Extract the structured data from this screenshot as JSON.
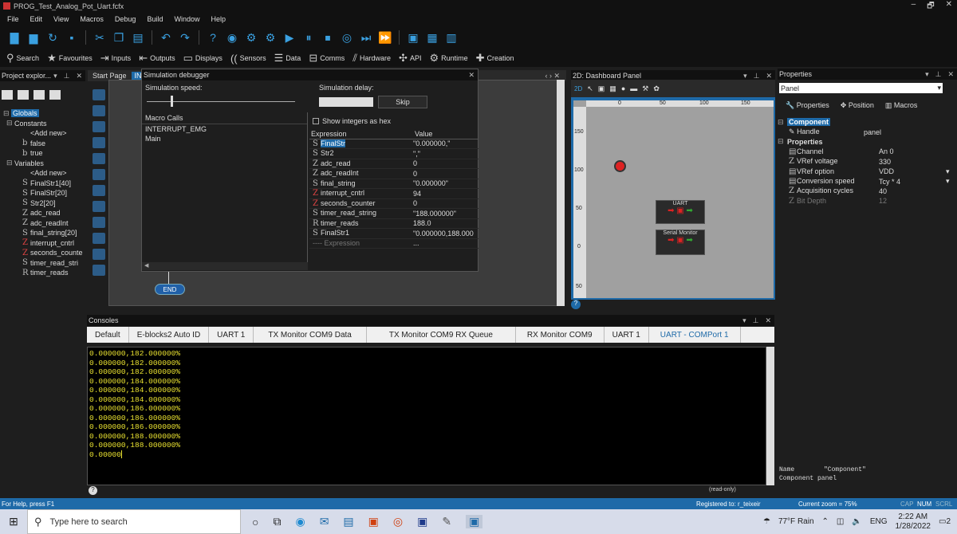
{
  "window": {
    "title": "PROG_Test_Analog_Pot_Uart.fcfx",
    "controls": [
      "–",
      "🗗",
      "✕"
    ]
  },
  "menu": [
    "File",
    "Edit",
    "View",
    "Macros",
    "Debug",
    "Build",
    "Window",
    "Help"
  ],
  "commands": [
    {
      "icon": "search-icon",
      "label": "Search"
    },
    {
      "icon": "star-icon",
      "label": "Favourites"
    },
    {
      "icon": "inputs-icon",
      "label": "Inputs"
    },
    {
      "icon": "outputs-icon",
      "label": "Outputs"
    },
    {
      "icon": "displays-icon",
      "label": "Displays"
    },
    {
      "icon": "sensors-icon",
      "label": "Sensors"
    },
    {
      "icon": "data-icon",
      "label": "Data"
    },
    {
      "icon": "comms-icon",
      "label": "Comms"
    },
    {
      "icon": "hardware-icon",
      "label": "Hardware"
    },
    {
      "icon": "api-icon",
      "label": "API"
    },
    {
      "icon": "runtime-icon",
      "label": "Runtime"
    },
    {
      "icon": "creation-icon",
      "label": "Creation"
    }
  ],
  "project": {
    "title": "Project explor...",
    "items": [
      "Globals",
      "Constants",
      "<Add new>",
      "false",
      "true",
      "Variables",
      "<Add new>",
      "FinalStr1[40]",
      "FinalStr[20]",
      "Str2[20]",
      "adc_read",
      "adc_readInt",
      "final_string[20]",
      "interrupt_cntrl",
      "seconds_counte",
      "timer_read_stri",
      "timer_reads"
    ]
  },
  "tabs": {
    "start": "Start Page",
    "active": "INT"
  },
  "canvas": {
    "end_label": "END"
  },
  "debugger": {
    "title": "Simulation debugger",
    "speed_label": "Simulation speed:",
    "delay_label": "Simulation delay:",
    "skip": "Skip",
    "show_hex": "Show integers as hex",
    "macro_calls": "Macro Calls",
    "macros": [
      "INTERRUPT_EMG",
      "Main"
    ],
    "col_expr": "Expression",
    "col_val": "Value",
    "vars": [
      [
        "FinalStr",
        "\"0.000000,\""
      ],
      [
        "Str2",
        "\",\""
      ],
      [
        "adc_read",
        "0"
      ],
      [
        "adc_readInt",
        "0"
      ],
      [
        "final_string",
        "\"0.000000\""
      ],
      [
        "interrupt_cntrl",
        "94"
      ],
      [
        "seconds_counter",
        "0"
      ],
      [
        "timer_read_string",
        "\"188.000000\""
      ],
      [
        "timer_reads",
        "188.0"
      ],
      [
        "FinalStr1",
        "\"0.000000,188.000"
      ]
    ],
    "expr_placeholder": "Expression",
    "expr_val": "..."
  },
  "dashboard": {
    "title": "2D: Dashboard Panel",
    "ruler_top": [
      "0",
      "50",
      "100",
      "150"
    ],
    "ruler_left": [
      "150",
      "100",
      "50",
      "0",
      "50"
    ],
    "uart_label": "UART",
    "serial_label": "Serial Monitor"
  },
  "properties": {
    "title": "Properties",
    "selector": "Panel",
    "tabs": [
      "Properties",
      "Position",
      "Macros"
    ],
    "rows": [
      {
        "name": "Component",
        "value": "",
        "section": true
      },
      {
        "name": "Handle",
        "value": "panel"
      },
      {
        "name": "Properties",
        "value": "",
        "section": true
      },
      {
        "name": "Channel",
        "value": "An 0"
      },
      {
        "name": "VRef voltage",
        "value": "330"
      },
      {
        "name": "VRef option",
        "value": "VDD"
      },
      {
        "name": "Conversion speed",
        "value": "Tcy * 4"
      },
      {
        "name": "Acquisition cycles",
        "value": "40"
      },
      {
        "name": "Bit Depth",
        "value": "12"
      }
    ],
    "footer_name": "Name",
    "footer_name_val": "\"Component\"",
    "footer_comp": "Component panel"
  },
  "consoles": {
    "title": "Consoles",
    "tabs": [
      "Default",
      "E-blocks2 Auto ID",
      "UART 1",
      "TX Monitor COM9 Data",
      "TX Monitor COM9 RX Queue",
      "RX Monitor COM9",
      "UART 1",
      "UART - COMPort 1"
    ],
    "lines": [
      "0.000000,182.000000%",
      "0.000000,182.000000%",
      "0.000000,182.000000%",
      "0.000000,184.000000%",
      "0.000000,184.000000%",
      "0.000000,184.000000%",
      "0.000000,186.000000%",
      "0.000000,186.000000%",
      "0.000000,186.000000%",
      "0.000000,188.000000%",
      "0.000000,188.000000%",
      "0.00000"
    ],
    "readonly": "(read-only)"
  },
  "status": {
    "help": "For Help, press F1",
    "registered": "Registered to: r_teixeir",
    "zoom": "Current zoom = 75%",
    "caps": "CAP",
    "num": "NUM",
    "scrl": "SCRL"
  },
  "taskbar": {
    "search": "Type here to search",
    "weather": "77°F Rain",
    "lang": "ENG",
    "time": "2:22 AM",
    "date": "1/28/2022",
    "notif": "2"
  },
  "colors": {
    "accent": "#1e6aa8",
    "console_text": "#e8e030",
    "selection": "#1e6aa8"
  }
}
